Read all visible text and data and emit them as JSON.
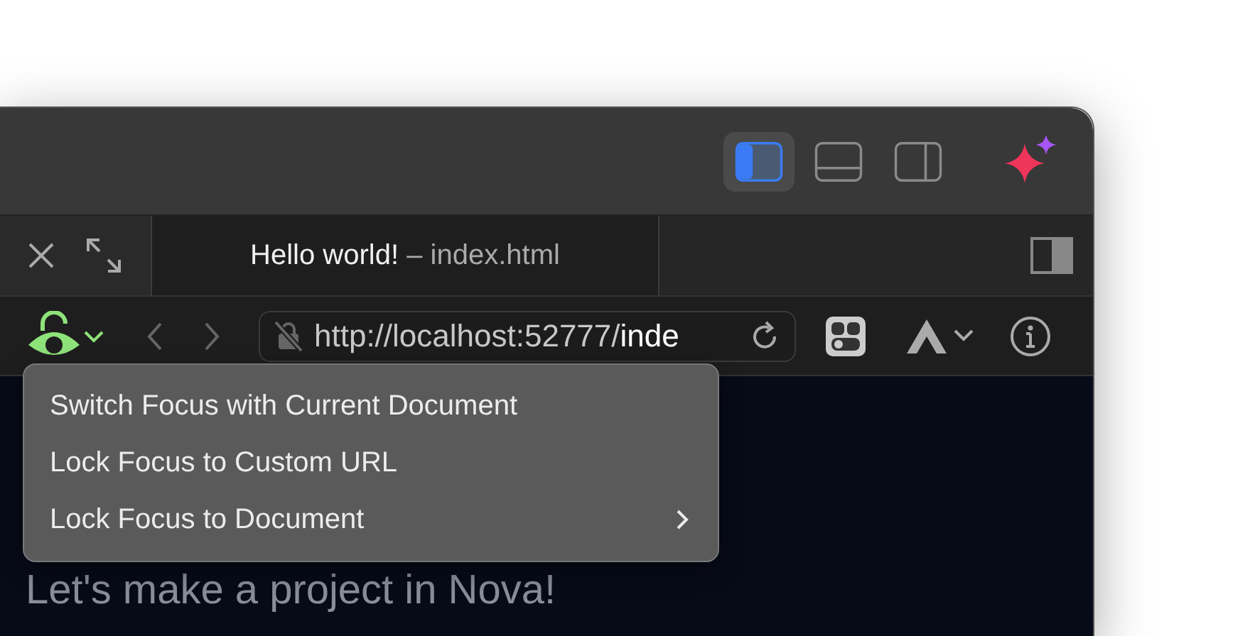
{
  "title_bar": {
    "layout_buttons": [
      {
        "selected": true
      },
      {
        "selected": false
      },
      {
        "selected": false
      }
    ]
  },
  "tab_bar": {
    "tab": {
      "title": "Hello world!",
      "subtitle": "– index.html"
    }
  },
  "toolbar": {
    "url_base": "http://localhost:52777/",
    "url_path": "inde"
  },
  "menu": [
    {
      "label": "Switch Focus with Current Document",
      "submenu": false
    },
    {
      "label": "Lock Focus to Custom URL",
      "submenu": false
    },
    {
      "label": "Lock Focus to Document",
      "submenu": true
    }
  ],
  "content": {
    "heading": "Let's make a project in Nova!"
  }
}
